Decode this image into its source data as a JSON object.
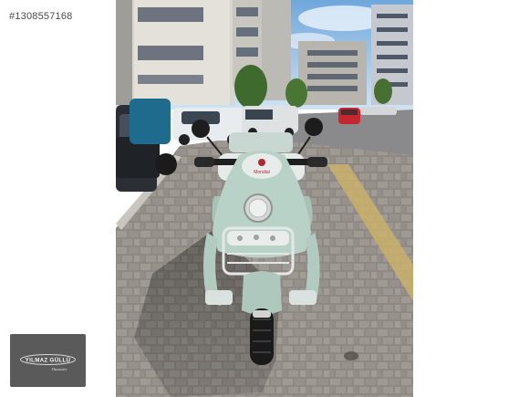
{
  "listing": {
    "id_text": "#1308557168"
  },
  "watermark": {
    "brand": "YILMAZ GÜLLÜ",
    "tagline": "Otomotiv"
  },
  "photo": {
    "scooter_brand_text": "Mondial"
  },
  "colors": {
    "page_background": "#ffffff",
    "scooter_body": "#b9d2c8",
    "scooter_seat": "#e9eeea",
    "paving": "#8f8a86",
    "sky": "#9cc6ea",
    "watermark_bg": "#5a5a5a"
  }
}
